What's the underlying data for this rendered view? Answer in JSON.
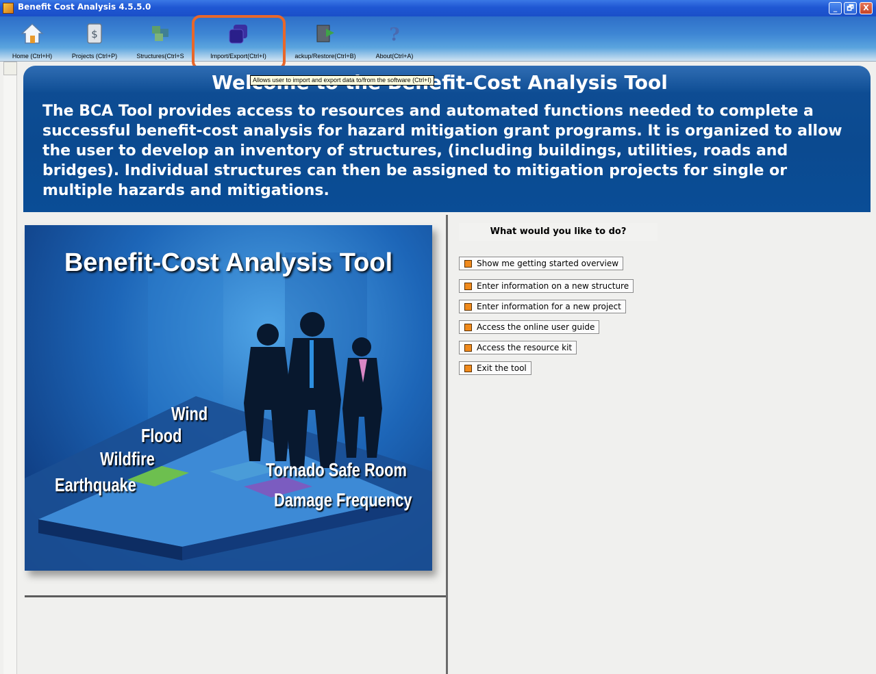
{
  "window": {
    "title": "Benefit Cost Analysis 4.5.5.0",
    "controls": [
      "_",
      "🗗",
      "X"
    ]
  },
  "toolbar": {
    "items": [
      {
        "label": "Home (Ctrl+H)",
        "icon": "home-icon"
      },
      {
        "label": "Projects (Ctrl+P)",
        "icon": "projects-icon"
      },
      {
        "label": "Structures(Ctrl+S",
        "icon": "structures-icon"
      },
      {
        "label": "Import/Export(Ctrl+I)",
        "icon": "import-export-icon"
      },
      {
        "label": "ackup/Restore(Ctrl+B)",
        "icon": "backup-restore-icon"
      },
      {
        "label": "About(Ctrl+A)",
        "icon": "about-icon"
      }
    ],
    "highlight_color": "#e8672a",
    "tooltip": "Allows user to import and export data to/from the software (Ctrl+I)"
  },
  "banner": {
    "title": "Welcome to the Benefit-Cost Analysis Tool",
    "text": "The BCA Tool provides access to resources and automated functions needed to complete a successful benefit-cost analysis for hazard mitigation grant programs.  It is organized to allow the user to develop an inventory of structures, (including buildings, utilities, roads and bridges). Individual structures can then be assigned to mitigation projects for single or multiple hazards and mitigations."
  },
  "poster": {
    "title": "Benefit-Cost Analysis Tool",
    "hazards_left": [
      "Wind",
      "Flood",
      "Wildfire",
      "Earthquake"
    ],
    "hazards_right": [
      "Tornado Safe Room",
      "Damage Frequency"
    ]
  },
  "actions_panel": {
    "heading": "What would you like to do?",
    "items": [
      "Show me getting started overview",
      "Enter information on a new structure",
      "Enter information for a new project",
      "Access the online user guide",
      "Access the resource kit",
      "Exit the tool"
    ],
    "bullet_color": "#f08a1c"
  }
}
